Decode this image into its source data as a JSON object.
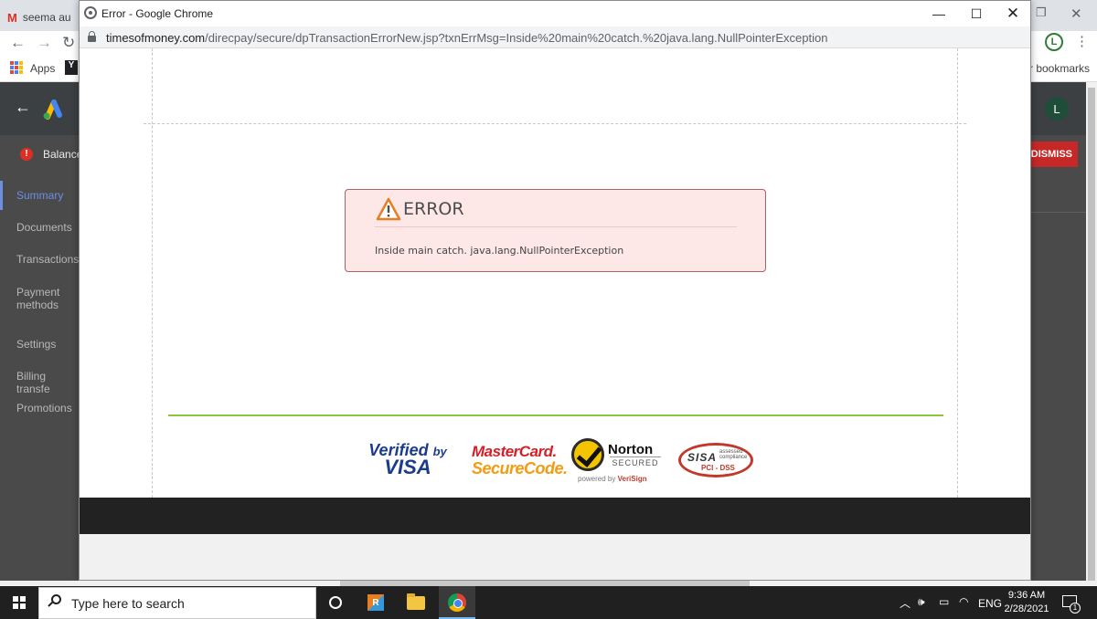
{
  "background_browser": {
    "tab_title": "seema au",
    "apps_label": "Apps",
    "bookmarks_label": "r bookmarks",
    "avatar_initial": "L",
    "ads_avatar_initial": "L",
    "banner_text": "Balance",
    "dismiss_label": "DISMISS",
    "sidebar": {
      "items": [
        {
          "label": "Summary",
          "active": true
        },
        {
          "label": "Documents"
        },
        {
          "label": "Transactions"
        },
        {
          "label": "Payment methods"
        },
        {
          "label": "Settings"
        },
        {
          "label": "Billing transfe"
        },
        {
          "label": "Promotions"
        }
      ]
    }
  },
  "popup": {
    "window_title": "Error - Google Chrome",
    "url_host": "timesofmoney.com",
    "url_path": "/direcpay/secure/dpTransactionErrorNew.jsp?txnErrMsg=Inside%20main%20catch.%20java.lang.NullPointerException",
    "error": {
      "heading": "ERROR",
      "message": "Inside main catch. java.lang.NullPointerException"
    },
    "security_logos": {
      "visa_line1": "Verified",
      "visa_by": "by",
      "visa_line2": "VISA",
      "mc_line1": "MasterCard.",
      "mc_line2": "SecureCode.",
      "norton_word": "Norton",
      "norton_secured": "SECURED",
      "norton_powered": "powered by",
      "norton_verisign": "VeriSign",
      "sisa_word": "SISA",
      "sisa_assessed": "assessed",
      "sisa_compliance": "compliance",
      "sisa_pci": "PCI - DSS"
    }
  },
  "taskbar": {
    "search_placeholder": "Type here to search",
    "language": "ENG",
    "time": "9:36 AM",
    "date": "2/28/2021",
    "notification_count": "1"
  },
  "colors": {
    "error_background": "#fde7e7",
    "error_border": "#b06060",
    "divider_green": "#8cc63e",
    "taskbar": "#202020"
  }
}
